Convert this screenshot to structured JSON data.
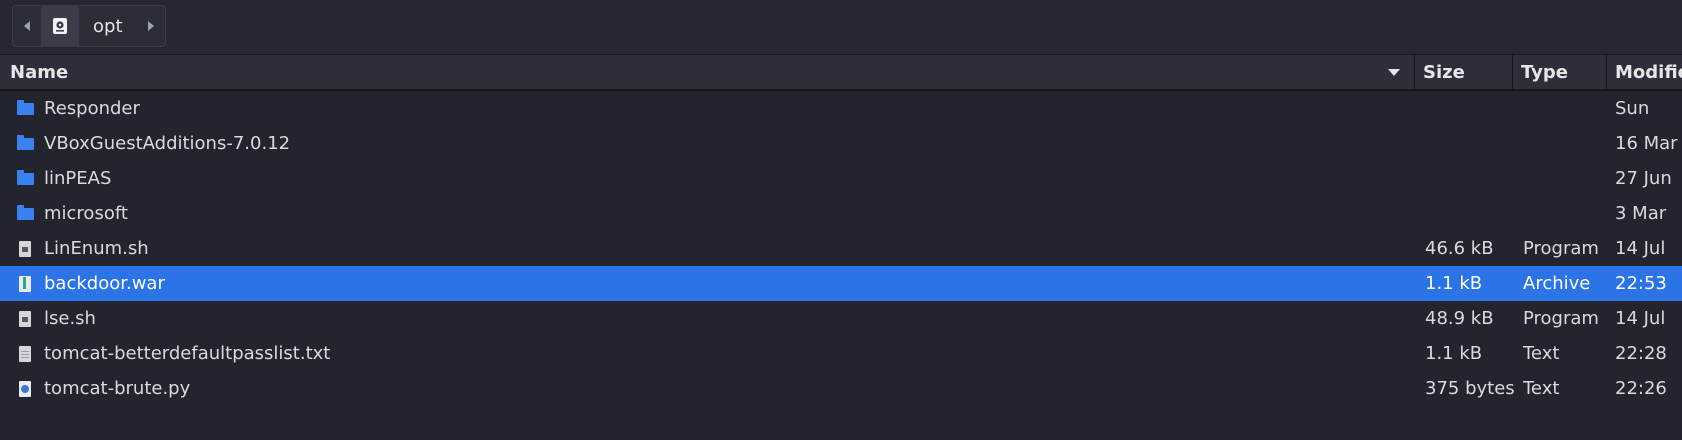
{
  "pathbar": {
    "current_folder": "opt"
  },
  "columns": {
    "name": "Name",
    "size": "Size",
    "type": "Type",
    "modified": "Modified"
  },
  "files": [
    {
      "name": "Responder",
      "size": "",
      "type": "",
      "modified": "Sun",
      "icon": "folder-icon"
    },
    {
      "name": "VBoxGuestAdditions-7.0.12",
      "size": "",
      "type": "",
      "modified": "16 Mar",
      "icon": "folder-icon"
    },
    {
      "name": "linPEAS",
      "size": "",
      "type": "",
      "modified": "27 Jun",
      "icon": "folder-icon"
    },
    {
      "name": "microsoft",
      "size": "",
      "type": "",
      "modified": "3 Mar",
      "icon": "folder-icon"
    },
    {
      "name": "LinEnum.sh",
      "size": "46.6 kB",
      "type": "Program",
      "modified": "14 Jul",
      "icon": "script-file-icon"
    },
    {
      "name": "backdoor.war",
      "size": "1.1 kB",
      "type": "Archive",
      "modified": "22:53",
      "icon": "archive-file-icon",
      "selected": true
    },
    {
      "name": "lse.sh",
      "size": "48.9 kB",
      "type": "Program",
      "modified": "14 Jul",
      "icon": "script-file-icon"
    },
    {
      "name": "tomcat-betterdefaultpasslist.txt",
      "size": "1.1 kB",
      "type": "Text",
      "modified": "22:28",
      "icon": "text-file-icon"
    },
    {
      "name": "tomcat-brute.py",
      "size": "375 bytes",
      "type": "Text",
      "modified": "22:26",
      "icon": "python-file-icon"
    }
  ],
  "colors": {
    "background": "#23252e",
    "header": "#2c2f39",
    "selection": "#2a74e8",
    "folder": "#3b82f1"
  }
}
